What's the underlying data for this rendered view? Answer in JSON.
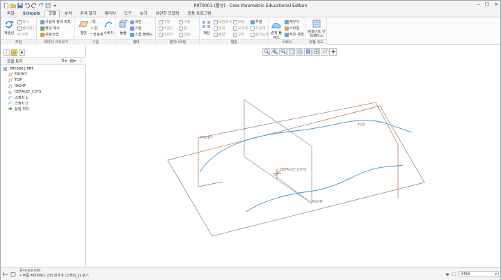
{
  "window": {
    "title": "PRT0001 (활성) - Creo Parametric Educational Edition"
  },
  "tabs": [
    {
      "label": "파일"
    },
    {
      "label": "Schools"
    },
    {
      "label": "모델"
    },
    {
      "label": "분석"
    },
    {
      "label": "주석 달기"
    },
    {
      "label": "렌더링"
    },
    {
      "label": "도구"
    },
    {
      "label": "보기"
    },
    {
      "label": "유연한 모델링"
    },
    {
      "label": "응용 프로그램"
    }
  ],
  "ribbon": {
    "ops": {
      "regen": "재생성",
      "copy": "복사",
      "paste": "붙여넣기",
      "delete": "삭제",
      "label": "작업"
    },
    "data": {
      "udf": "사용자 정의 피처",
      "copy_geom": "형상 복사",
      "shrinkwrap": "쉬링크랩",
      "label": "데이터 가져오기"
    },
    "datum": {
      "plane": "평면",
      "axis": "축",
      "point": "점",
      "csys": "좌표계",
      "sketch": "스케치",
      "label": "기준"
    },
    "shapes": {
      "extrude": "돌출",
      "revolve": "회전",
      "sweep": "스윕",
      "swept_blend": "스윕 블렌드",
      "label": "형태"
    },
    "engineering": {
      "hole": "구멍",
      "round": "라운드",
      "chamfer": "모따기",
      "rib": "구배",
      "shell": "쉘",
      "draft": "리브",
      "label": "엔지니어링"
    },
    "editing": {
      "pattern": "패턴",
      "mirror": "대칭복사",
      "extend": "연장",
      "trim": "트림",
      "merge": "병합",
      "offset": "오프셋",
      "intersect": "교차",
      "project": "투영",
      "thicken": "두껍게",
      "solidify": "솔리드화",
      "label": "편집"
    },
    "surfaces": {
      "boundary": "경계 블렌드",
      "fill": "채우기",
      "style": "스타일",
      "freestyle": "자유 유형",
      "label": "서피스"
    },
    "model_intent": {
      "component_interface": "컴포넌트 인터페이스",
      "label": "모델 의도"
    }
  },
  "model_tree": {
    "header": "모델 트리",
    "items": [
      {
        "label": "PRT0001.PRT",
        "icon": "part-icon"
      },
      {
        "label": "FRONT",
        "icon": "datum-plane-icon"
      },
      {
        "label": "TOP",
        "icon": "datum-plane-icon"
      },
      {
        "label": "RIGHT",
        "icon": "datum-plane-icon"
      },
      {
        "label": "DEFAULT_CSYS",
        "icon": "csys-icon"
      },
      {
        "label": "스케치 1",
        "icon": "sketch-icon"
      },
      {
        "label": "스케치 2",
        "icon": "sketch-icon"
      },
      {
        "label": "삽입 위치",
        "icon": "insert-here-icon"
      }
    ]
  },
  "scene": {
    "plane_labels": {
      "front": "FRONT",
      "top": "TOP",
      "right": "RIGHT"
    },
    "csys_label": "DEFAULT_CSYS",
    "colors": {
      "plane": "#a0704f",
      "curve": "#3d8fd1",
      "csys": "#8a6a52",
      "background": "#ffffff"
    }
  },
  "status": {
    "message_1": "동작/강조사항:",
    "message_2": "• 부품 PRT0001 안의 피처 6 (스케치_2) 보기",
    "selection_filter": "스마트"
  }
}
